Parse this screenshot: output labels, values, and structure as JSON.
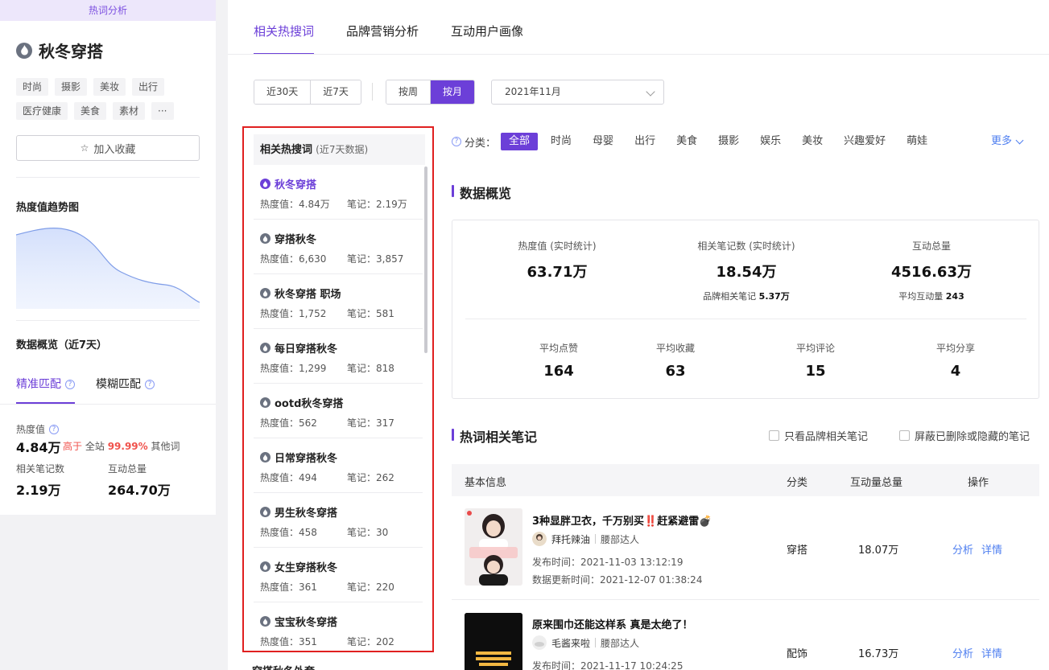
{
  "left": {
    "banner": "热词分析",
    "keyword": "秋冬穿搭",
    "tags": [
      "时尚",
      "摄影",
      "美妆",
      "出行",
      "医疗健康",
      "美食",
      "素材",
      "···"
    ],
    "fav_label": "加入收藏",
    "trend_title": "热度值趋势图",
    "overview_title": "数据概览（近7天）",
    "match_tabs": [
      "精准匹配",
      "模糊匹配"
    ],
    "heat_label": "热度值",
    "heat_value": "4.84万",
    "heat_compare_prefix": "高于",
    "heat_compare_mid": "全站",
    "heat_compare_pct": "99.99%",
    "heat_compare_suffix": "其他词",
    "notes_label": "相关笔记数",
    "notes_value": "2.19万",
    "inter_label": "互动总量",
    "inter_value": "264.70万"
  },
  "tabs": [
    "相关热搜词",
    "品牌营销分析",
    "互动用户画像"
  ],
  "range_buttons": [
    "近30天",
    "近7天"
  ],
  "period_buttons": [
    "按周",
    "按月"
  ],
  "month_value": "2021年11月",
  "kw_list": {
    "title": "相关热搜词",
    "subtitle": "(近7天数据)",
    "items": [
      {
        "name": "秋冬穿搭",
        "heat": "热度值：4.84万",
        "notes": "笔记：2.19万"
      },
      {
        "name": "穿搭秋冬",
        "heat": "热度值：6,630",
        "notes": "笔记：3,857"
      },
      {
        "name": "秋冬穿搭 职场",
        "heat": "热度值：1,752",
        "notes": "笔记：581"
      },
      {
        "name": "每日穿搭秋冬",
        "heat": "热度值：1,299",
        "notes": "笔记：818"
      },
      {
        "name": "ootd秋冬穿搭",
        "heat": "热度值：562",
        "notes": "笔记：317"
      },
      {
        "name": "日常穿搭秋冬",
        "heat": "热度值：494",
        "notes": "笔记：262"
      },
      {
        "name": "男生秋冬穿搭",
        "heat": "热度值：458",
        "notes": "笔记：30"
      },
      {
        "name": "女生穿搭秋冬",
        "heat": "热度值：361",
        "notes": "笔记：220"
      },
      {
        "name": "宝宝秋冬穿搭",
        "heat": "热度值：351",
        "notes": "笔记：202"
      }
    ],
    "below": "穿搭秋冬外套"
  },
  "categories": {
    "label": "分类：",
    "items": [
      "全部",
      "时尚",
      "母婴",
      "出行",
      "美食",
      "摄影",
      "娱乐",
      "美妆",
      "兴趣爱好",
      "萌娃"
    ],
    "more": "更多"
  },
  "overview": {
    "title": "数据概览",
    "heat_label": "热度值 (实时统计)",
    "heat_value": "63.71万",
    "notes_label": "相关笔记数 (实时统计)",
    "notes_value": "18.54万",
    "brand_notes_label": "品牌相关笔记",
    "brand_notes_value": "5.37万",
    "inter_label": "互动总量",
    "inter_value": "4516.63万",
    "avg_inter_label": "平均互动量",
    "avg_inter_value": "243",
    "avg_like_label": "平均点赞",
    "avg_like_value": "164",
    "avg_fav_label": "平均收藏",
    "avg_fav_value": "63",
    "avg_comment_label": "平均评论",
    "avg_comment_value": "15",
    "avg_share_label": "平均分享",
    "avg_share_value": "4"
  },
  "notes_section": {
    "title": "热词相关笔记",
    "check1": "只看品牌相关笔记",
    "check2": "屏蔽已删除或隐藏的笔记",
    "headers": [
      "基本信息",
      "分类",
      "互动量总量",
      "操作"
    ],
    "rows": [
      {
        "title": "3种显胖卫衣，千万别买‼️赶紧避雷💣",
        "author": "拜托辣油",
        "role": "腰部达人",
        "publish": "发布时间：2021-11-03 13:12:19",
        "update": "数据更新时间：2021-12-07 01:38:24",
        "category": "穿搭",
        "interaction": "18.07万",
        "op1": "分析",
        "op2": "详情"
      },
      {
        "title": "原来围巾还能这样系 真是太绝了！",
        "author": "毛酱来啦",
        "role": "腰部达人",
        "publish": "发布时间：2021-11-17 10:24:25",
        "category": "配饰",
        "interaction": "16.73万",
        "op1": "分析",
        "op2": "详情"
      }
    ]
  },
  "colors": {
    "accent": "#6c3fd8",
    "link": "#4f7ff0",
    "highlight_red": "#e02020",
    "compare_red": "#f0524c"
  }
}
